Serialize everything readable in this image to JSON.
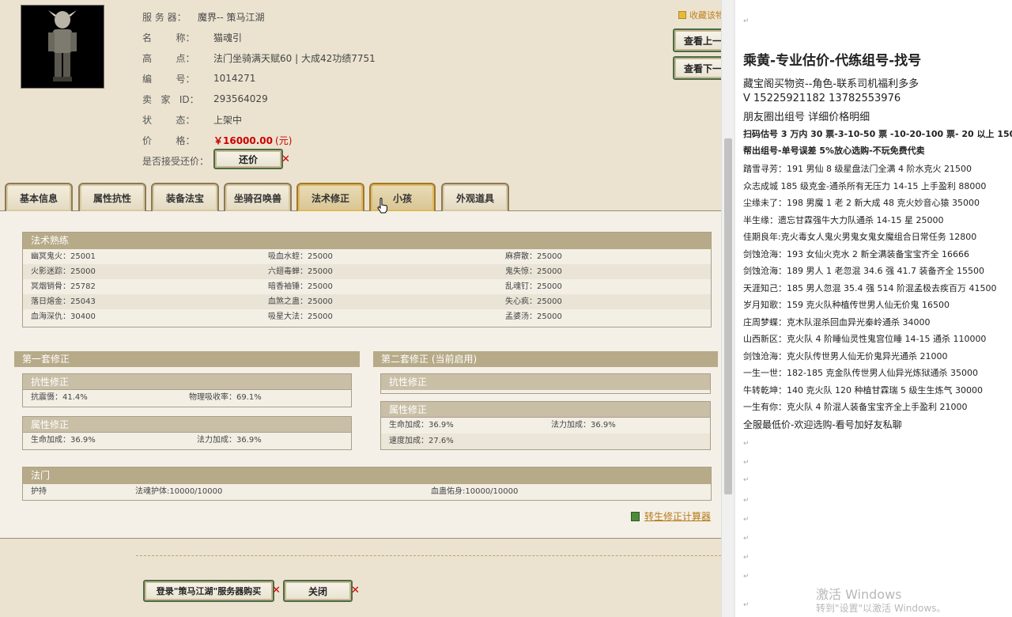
{
  "header": {
    "favorite": "收藏该物",
    "view_prev": "查看上一",
    "view_next": "查看下一"
  },
  "info": {
    "server_label": "服 务 器：",
    "server_value": "魔界-- 策马江湖",
    "name_label": "名        称：",
    "name_value": "猫魂引",
    "highlight_label": "高        点：",
    "highlight_value": "法门坐骑满天赋60 | 大成42功绩7751",
    "id_label": "编        号：",
    "id_value": "1014271",
    "seller_label": "卖   家   ID：",
    "seller_value": "293564029",
    "status_label": "状        态：",
    "status_value": "上架中",
    "price_label": "价        格：",
    "price_value": "￥16000.00",
    "price_unit": "(元)",
    "bargain_label": "是否接受还价：",
    "bargain_button": "还价"
  },
  "tabs": [
    {
      "label": "基本信息",
      "active": false
    },
    {
      "label": "属性抗性",
      "active": false
    },
    {
      "label": "装备法宝",
      "active": false
    },
    {
      "label": "坐骑召唤兽",
      "active": false
    },
    {
      "label": "法术修正",
      "active": true
    },
    {
      "label": "小孩",
      "active": true
    },
    {
      "label": "外观道具",
      "active": false
    }
  ],
  "spell_mastery": {
    "title": "法术熟练",
    "rows": [
      [
        "幽冥鬼火：25001",
        "吸血水蛭：25000",
        "麻痹散：25000"
      ],
      [
        "火影迷踪：25000",
        "六翅毒蝉：25000",
        "鬼失惊：25000"
      ],
      [
        "冥烟销骨：25782",
        "暗香袖锤：25000",
        "乱魂钉：25000"
      ],
      [
        "落日熔金：25043",
        "血煞之蛊：25000",
        "失心疯：25000"
      ],
      [
        "血海深仇：30400",
        "吸星大法：25000",
        "孟婆汤：25000"
      ]
    ]
  },
  "set1": {
    "title": "第一套修正",
    "resist_title": "抗性修正",
    "resist_values": [
      "抗震慑：41.4%",
      "物理吸收率：69.1%"
    ],
    "attr_title": "属性修正",
    "attr_values": [
      "生命加成：36.9%",
      "法力加成：36.9%"
    ]
  },
  "set2": {
    "title": "第二套修正 (当前启用)",
    "resist_title": "抗性修正",
    "attr_title": "属性修正",
    "attr_values": [
      "生命加成：36.9%",
      "法力加成：36.9%"
    ],
    "attr_values2": [
      "速度加成：27.6%"
    ]
  },
  "sect": {
    "title": "法门",
    "values": [
      "护持",
      "法魂护体:10000/10000",
      "血蛊佑身:10000/10000"
    ]
  },
  "calculator_link": "转生修正计算器",
  "bottom": {
    "login_button": "登录\"策马江湖\"服务器购买",
    "close_button": "关闭"
  },
  "document": {
    "title": "乘黄-专业估价-代练组号-找号",
    "lines": [
      "藏宝阁买物资--角色-联系司机福利多多",
      "V 15225921182    13782553976",
      "朋友圈出组号    详细价格明细"
    ],
    "bold_lines": [
      "扫码估号 3 万内 30 票-3-10-50 票  -10-20-100 票- 20 以上 150",
      "帮出组号-单号误差 5%放心选购-不玩免费代卖"
    ],
    "listings": [
      "踏雪寻芳：191 男仙 8 级星盘法门全满 4 阶水克火 21500",
      "众志成城  185 级克金-通杀所有无压力 14-15 上手盈利 88000",
      "尘缘未了：198 男魔 1 老 2 新大成 48 克火妙音心猿 35000",
      "半生缘：遗忘甘霖强牛大力队通杀 14-15 星 25000",
      "佳期良年:克火毒女人鬼火男鬼女鬼女魔组合日常任务 12800",
      "剑蚀沧海：193 女仙火克水 2 新全满装备宝宝齐全 16666",
      "剑蚀沧海：189 男人 1 老忽混 34.6 强 41.7 装备齐全 15500",
      "天涯知己：185 男人忽混 35.4 强 514 阶混孟极去疾百万 41500",
      "岁月知歌：159 克火队种植传世男人仙无价鬼 16500",
      "庄周梦蝶：克木队混杀回血异光秦岭通杀 34000",
      "山西新区：克火队 4 阶睡仙灵性鬼宫位睡 14-15 通杀 110000",
      "剑蚀沧海：克火队传世男人仙无价鬼异光通杀 21000",
      "一生一世：182-185 克金队传世男人仙异光炼狱通杀 35000",
      "牛转乾坤：140 克火队 120 种植甘霖瑞 5 级生生炼气 30000",
      "一生有你：克火队 4 阶混人装备宝宝齐全上手盈利 21000"
    ],
    "closing": "全服最低价-欢迎选购-看号加好友私聊",
    "para_mark": "↵",
    "watermark1": "激活 Windows",
    "watermark2": "转到\"设置\"以激活 Windows。"
  }
}
